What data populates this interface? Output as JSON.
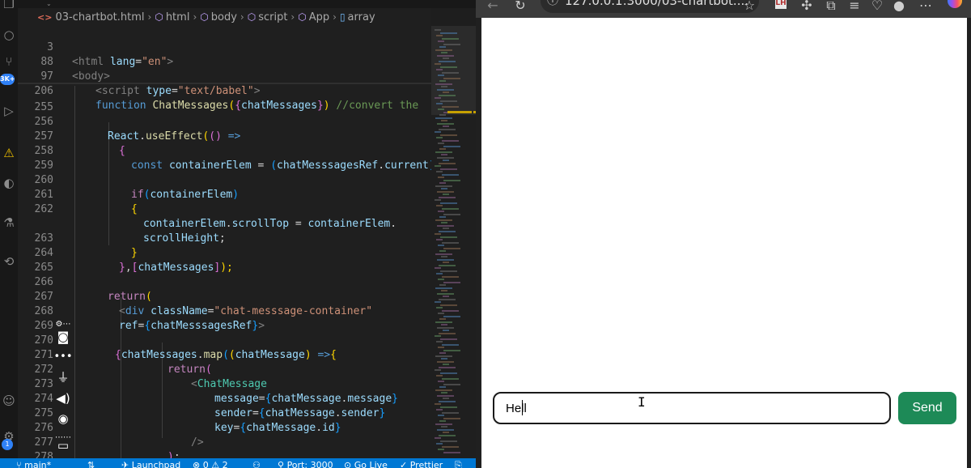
{
  "vscode": {
    "breadcrumb": {
      "file": "03-chartbot.html",
      "items": [
        "html",
        "body",
        "script",
        "App",
        "array"
      ]
    },
    "activity_bar": {
      "badge": "3K+",
      "small_badge": "1"
    },
    "code_lines": [
      {
        "ln": "3"
      },
      {
        "ln": "88"
      },
      {
        "ln": "97"
      },
      {
        "ln": "206"
      },
      {
        "ln": "255"
      },
      {
        "ln": "256"
      },
      {
        "ln": "257"
      },
      {
        "ln": "258"
      },
      {
        "ln": "259"
      },
      {
        "ln": "260"
      },
      {
        "ln": "261"
      },
      {
        "ln": "262"
      },
      {
        "ln": ""
      },
      {
        "ln": "263"
      },
      {
        "ln": "264"
      },
      {
        "ln": "265"
      },
      {
        "ln": "266"
      },
      {
        "ln": "267"
      },
      {
        "ln": "268"
      },
      {
        "ln": "269"
      },
      {
        "ln": "270"
      },
      {
        "ln": "271"
      },
      {
        "ln": "272"
      },
      {
        "ln": "273"
      },
      {
        "ln": "274"
      },
      {
        "ln": "275"
      },
      {
        "ln": "276"
      },
      {
        "ln": "277"
      },
      {
        "ln": "278"
      }
    ],
    "code_text": {
      "l3a": "<html ",
      "l3b": "lang",
      "l3c": "=",
      "l3d": "\"en\"",
      "l3e": ">",
      "l88": "<body>",
      "l97a": "<script ",
      "l97b": "type",
      "l97c": "=",
      "l97d": "\"text/babel\"",
      "l97e": ">",
      "l206a": "function ",
      "l206b": "ChatMessages",
      "l206c": "(",
      "l206d": "{",
      "l206e": "chatMessages",
      "l206f": "}",
      "l206g": ")",
      "l206h": " //convert the",
      "l256a": "React",
      "l256b": ".",
      "l256c": "useEffect",
      "l256d": "(",
      "l256e": "()",
      "l256f": " =>",
      "l257": "{",
      "l258a": "const ",
      "l258b": "containerElem",
      "l258c": " = ",
      "l258d": "(",
      "l258e": "chatMesssagesRef",
      "l258f": ".",
      "l258g": "current",
      "l258h": ");",
      "l260a": "if",
      "l260b": "(",
      "l260c": "containerElem",
      "l260d": ")",
      "l261": "{",
      "l262a": "containerElem",
      "l262b": ".",
      "l262c": "scrollTop",
      "l262d": " = ",
      "l262e": "containerElem",
      "l262f": ".",
      "l262g": "scrollHeight",
      "l262h": ";",
      "l263": "}",
      "l264a": "}",
      "l264b": ",",
      "l264c": "[",
      "l264d": "chatMessages",
      "l264e": "]",
      "l264f": ");",
      "l266a": "return",
      "l266b": "(",
      "l267a": "<",
      "l267b": "div ",
      "l267c": "className",
      "l267d": "=",
      "l267e": "\"chat-messsage-container\"",
      "l268a": "ref",
      "l268b": "=",
      "l268c": "{",
      "l268d": "chatMesssagesRef",
      "l268e": "}",
      "l268f": ">",
      "l270a": "{",
      "l270b": "chatMessages",
      "l270c": ".",
      "l270d": "map",
      "l270e": "(",
      "l270f": "(",
      "l270g": "chatMessage",
      "l270h": ")",
      "l270i": " =>",
      "l270j": "{",
      "l271a": "return",
      "l271b": "(",
      "l272a": "<",
      "l272b": "ChatMessage",
      "l273a": "message",
      "l273b": "=",
      "l273c": "{",
      "l273d": "chatMessage",
      "l273e": ".",
      "l273f": "message",
      "l273g": "}",
      "l274a": "sender",
      "l274b": "=",
      "l274c": "{",
      "l274d": "chatMessage",
      "l274e": ".",
      "l274f": "sender",
      "l274g": "}",
      "l275a": "key",
      "l275b": "=",
      "l275c": "{",
      "l275d": "chatMessage",
      "l275e": ".",
      "l275f": "id",
      "l275g": "}",
      "l276": "/>",
      "l277a": ")",
      "l277b": ";",
      "l278a": "}",
      "l278b": ")",
      "l278c": "}"
    },
    "status_bar": {
      "branch": "main*",
      "launchpad": "Launchpad",
      "problems": "⊗ 0 ⚠ 2",
      "port": "Port: 3000",
      "golive": "Go Live",
      "prettier": "Prettier"
    }
  },
  "browser": {
    "url": "127.0.0.1:3000/03-chartbot....",
    "read_aloud": "Aᵃ",
    "chat": {
      "input_value": "Hell",
      "send_label": "Send"
    }
  },
  "colors": {
    "send_button": "#1d8a57",
    "status_bar": "#0078d4"
  }
}
